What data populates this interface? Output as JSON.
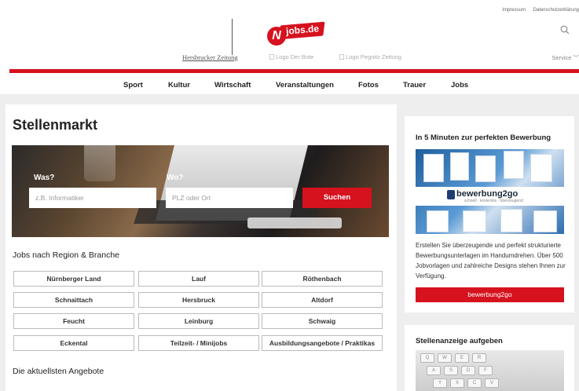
{
  "header": {
    "top_links": [
      "Impressum",
      "Datenschutzerklärung"
    ],
    "logo_hersbrucker": "Hersbrucker Zeitung",
    "logo_njobs": "jobs.de",
    "logo_njobs_badge": "N",
    "logo_bote": "Logo Der Bote",
    "logo_pegnitz": "Logo Pegnitz Zeitung",
    "service": "Service ﹀"
  },
  "nav": {
    "items": [
      "Sport",
      "Kultur",
      "Wirtschaft",
      "Veranstaltungen",
      "Fotos",
      "Trauer",
      "Jobs"
    ]
  },
  "main": {
    "title": "Stellenmarkt",
    "search": {
      "what_label": "Was?",
      "what_placeholder": "z.B. Informatiker",
      "where_label": "Wo?",
      "where_placeholder": "PLZ oder Ort",
      "submit": "Suchen"
    },
    "regions_title": "Jobs nach Region & Branche",
    "regions": [
      "Nürnberger Land",
      "Lauf",
      "Röthenbach",
      "Schnaittach",
      "Hersbruck",
      "Altdorf",
      "Feucht",
      "Leinburg",
      "Schwaig",
      "Eckental",
      "Teilzeit- / Minijobs",
      "Ausbildungsangebote / Praktikas"
    ],
    "latest_title": "Die aktuellsten Angebote"
  },
  "sidebar": {
    "card1": {
      "title": "In 5 Minuten zur perfekten Bewerbung",
      "banner_logo": "bewerbung2go",
      "banner_sub": "schnell · kostenlos · überzeugend",
      "text": "Erstellen Sie überzeugende und perfekt strukturierte Bewerbungsunterlagen im Handumdrehen. Über 500 Jobvorlagen und zahlreiche Designs stehen Ihnen zur Verfügung.",
      "button": "bewerbung2go"
    },
    "card2": {
      "title": "Stellenanzeige aufgeben",
      "keys": [
        "Q",
        "W",
        "E",
        "R",
        "A",
        "S",
        "D",
        "F",
        "Y",
        "X",
        "C",
        "V"
      ]
    }
  },
  "colors": {
    "accent": "#d6121f",
    "background": "#eeeeee"
  }
}
